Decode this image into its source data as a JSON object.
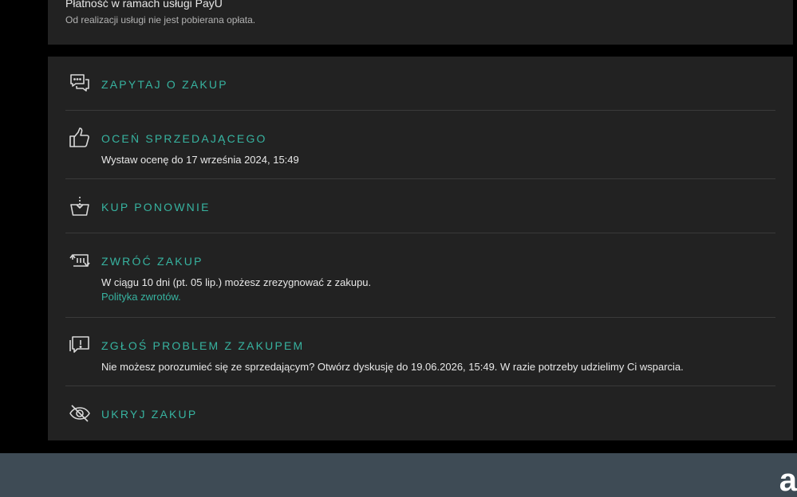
{
  "payment": {
    "title": "Płatność w ramach usługi PayU",
    "subtitle": "Od realizacji usługi nie jest pobierana opłata."
  },
  "actions": {
    "ask": {
      "label": "ZAPYTAJ O ZAKUP",
      "icon": "chat-bubbles-icon"
    },
    "rate": {
      "label": "OCEŃ SPRZEDAJĄCEGO",
      "icon": "thumbs-up-icon",
      "description": "Wystaw ocenę do 17 września 2024, 15:49"
    },
    "buy_again": {
      "label": "KUP PONOWNIE",
      "icon": "basket-download-icon"
    },
    "return": {
      "label": "ZWRÓĆ ZAKUP",
      "icon": "return-cart-icon",
      "description": "W ciągu 10 dni (pt. 05 lip.) możesz zrezygnować z zakupu.",
      "link": "Polityka zwrotów."
    },
    "report": {
      "label": "ZGŁOŚ PROBLEM Z ZAKUPEM",
      "icon": "report-problem-icon",
      "description": "Nie możesz porozumieć się ze sprzedającym? Otwórz dyskusję do 19.06.2026, 15:49. W razie potrzeby udzielimy Ci wsparcia."
    },
    "hide": {
      "label": "UKRYJ ZAKUP",
      "icon": "eye-off-icon"
    }
  },
  "footer": {
    "logo_letter": "a"
  },
  "colors": {
    "accent": "#37b3a0",
    "card": "#222222",
    "background": "#000000",
    "footer": "#3e4b55"
  }
}
